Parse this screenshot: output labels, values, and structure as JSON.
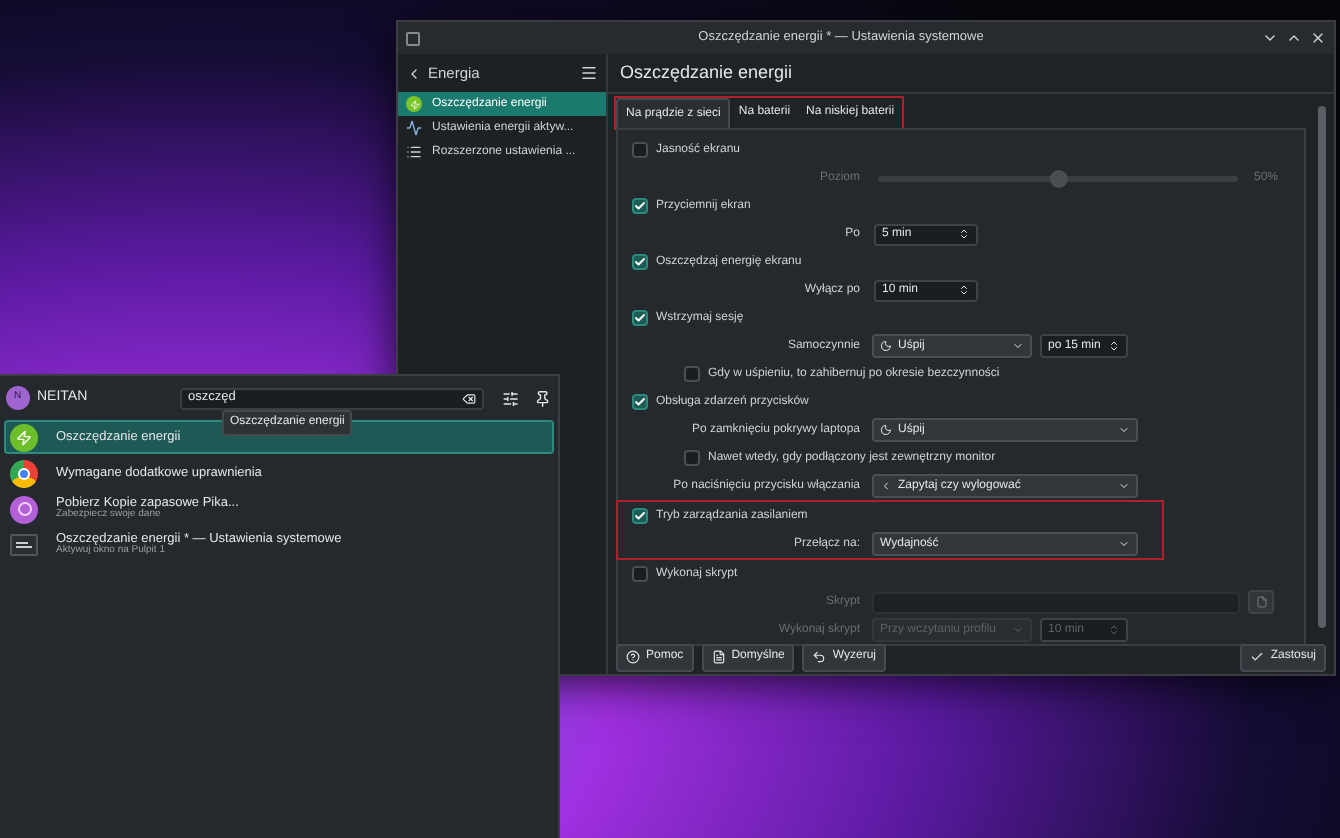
{
  "window": {
    "title": "Oszczędzanie energii * — Ustawienia systemowe"
  },
  "sidebar": {
    "back_label": "Energia",
    "items": [
      {
        "label": "Oszczędzanie energii",
        "selected": true
      },
      {
        "label": "Ustawienia energii aktyw...",
        "selected": false
      },
      {
        "label": "Rozszerzone ustawienia ...",
        "selected": false
      }
    ]
  },
  "page_title": "Oszczędzanie energii",
  "tabs_highlighted": true,
  "tabs": [
    {
      "label": "Na prądzie z sieci",
      "selected": true
    },
    {
      "label": "Na baterii",
      "selected": false
    },
    {
      "label": "Na niskiej baterii",
      "selected": false
    }
  ],
  "sections": [
    {
      "highlighted": false,
      "rows": [
        {
          "kind": "checkbox",
          "label": "Jasność ekranu",
          "checked": false
        },
        {
          "kind": "slider",
          "label": "Poziom",
          "level": 0.5,
          "reading": "50%",
          "disabled": true
        },
        {
          "kind": "checkbox",
          "label": "Przyciemnij ekran",
          "checked": true
        },
        {
          "kind": "spin",
          "label": "Po",
          "value": "5 min",
          "disabled": false
        },
        {
          "kind": "checkbox",
          "label": "Oszczędzaj energię ekranu",
          "checked": true
        },
        {
          "kind": "spin",
          "label": "Wyłącz po",
          "value": "10 min",
          "disabled": false
        },
        {
          "kind": "checkbox",
          "label": "Wstrzymaj sesję",
          "checked": true
        },
        {
          "kind": "combo_spin",
          "label": "Samoczynnie",
          "value": "Uśpij",
          "spin": "po 15 min",
          "disabled": false
        },
        {
          "kind": "subcheckbox",
          "label": "Gdy w uśpieniu, to zahibernuj po okresie bezczynności",
          "checked": false
        },
        {
          "kind": "checkbox",
          "label": "Obsługa zdarzeń przycisków",
          "checked": true
        },
        {
          "kind": "combo",
          "label": "Po zamknięciu pokrywy laptopa",
          "value": "Uśpij",
          "disabled": false
        },
        {
          "kind": "subcheckbox",
          "label": "Nawet wtedy, gdy podłączony jest zewnętrzny monitor",
          "checked": false
        },
        {
          "kind": "combo",
          "label": "Po naciśnięciu przycisku włączania",
          "value": "Zapytaj czy wylogować",
          "disabled": false
        }
      ]
    },
    {
      "highlighted": true,
      "rows": [
        {
          "kind": "checkbox",
          "label": "Tryb zarządzania zasilaniem",
          "checked": true
        },
        {
          "kind": "combo",
          "label": "Przełącz na:",
          "value": "Wydajność",
          "disabled": false
        }
      ]
    },
    {
      "highlighted": false,
      "rows": [
        {
          "kind": "checkbox",
          "label": "Wykonaj skrypt",
          "checked": false
        },
        {
          "kind": "file",
          "label": "Skrypt",
          "disabled": true
        },
        {
          "kind": "combo_spin",
          "label": "Wykonaj skrypt",
          "value": "Przy wczytaniu profilu",
          "spin": "10 min",
          "disabled": true
        }
      ]
    }
  ],
  "footer": {
    "left": [
      {
        "label": "Pomoc"
      },
      {
        "label": "Domyślne"
      },
      {
        "label": "Wyzeruj"
      }
    ],
    "right": [
      {
        "label": "Zastosuj"
      }
    ]
  },
  "launcher": {
    "user": {
      "initial": "N",
      "name": "NEITAN"
    },
    "search": {
      "value": "oszczęd"
    },
    "tooltip": "Oszczędzanie energii",
    "results": [
      {
        "kind": "power",
        "title": "Oszczędzanie energii",
        "selected": true
      },
      {
        "kind": "browser",
        "title": "Wymagane dodatkowe uprawnienia",
        "selected": false
      },
      {
        "kind": "app",
        "title": "Pobierz Kopie zapasowe Pika...",
        "subtitle": "Zabezpiecz swoje dane",
        "selected": false
      },
      {
        "kind": "window",
        "title": "Oszczędzanie energii * — Ustawienia systemowe",
        "subtitle": "Aktywuj okno na Pulpit 1",
        "selected": false
      }
    ]
  }
}
